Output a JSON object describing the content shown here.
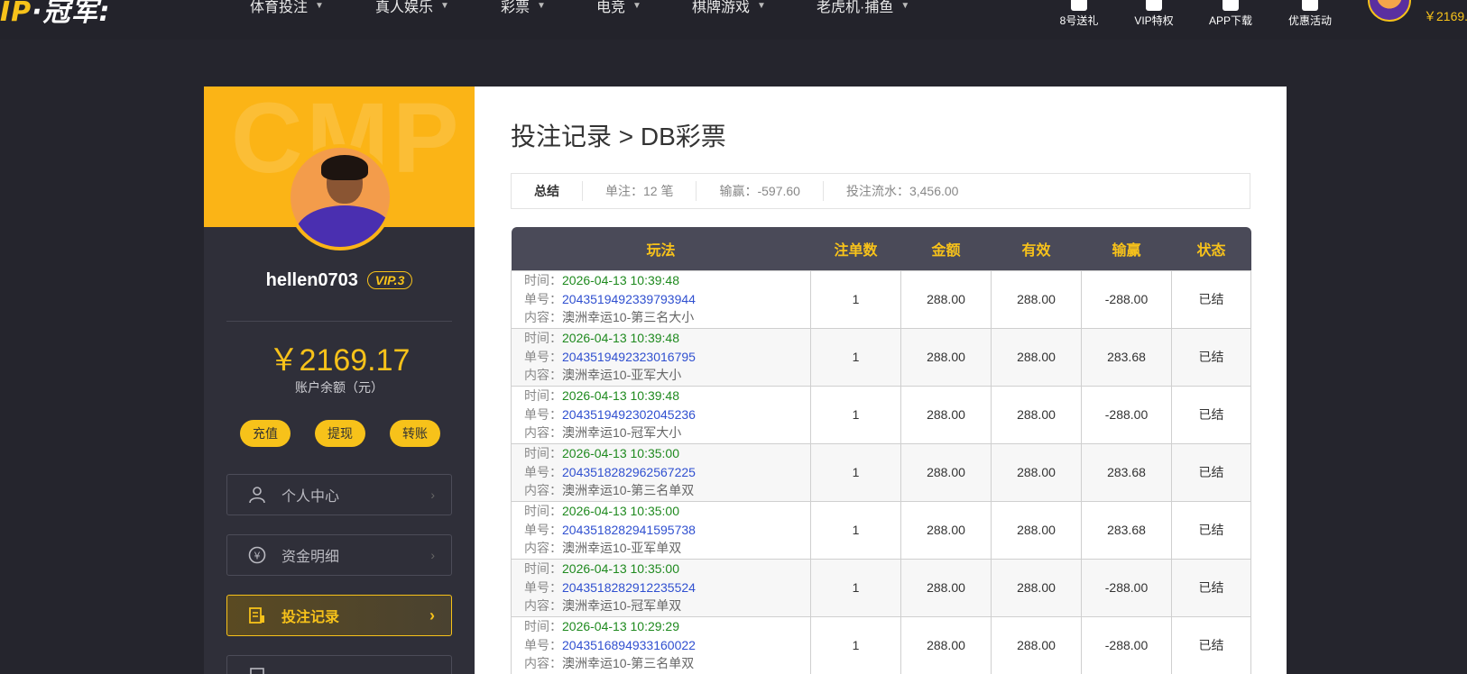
{
  "header": {
    "logo_left": "IP",
    "logo_right": "·冠军:",
    "nav": [
      "体育投注",
      "真人娱乐",
      "彩票",
      "电竞",
      "棋牌游戏",
      "老虎机·捕鱼"
    ],
    "right_links": [
      "8号送礼",
      "VIP特权",
      "APP下载",
      "优惠活动"
    ],
    "balance": "￥2169."
  },
  "sidebar": {
    "watermark": "CMP",
    "username": "hellen0703",
    "vip": "VIP.3",
    "balance": "￥2169.17",
    "balance_label": "账户余额（元）",
    "actions": [
      "充值",
      "提现",
      "转账"
    ],
    "menu": [
      {
        "label": "个人中心",
        "icon": "user-icon"
      },
      {
        "label": "资金明细",
        "icon": "yen-cycle-icon"
      },
      {
        "label": "投注记录",
        "icon": "bet-record-icon",
        "active": true
      }
    ]
  },
  "main": {
    "title": "投注记录 > DB彩票",
    "summary": {
      "head": "总结",
      "orders": "单注：12 笔",
      "win_loss": "输赢：-597.60",
      "turnover": "投注流水：3,456.00"
    },
    "table": {
      "columns": [
        "玩法",
        "注单数",
        "金额",
        "有效",
        "输赢",
        "状态"
      ],
      "labels": {
        "time": "时间：",
        "order": "单号：",
        "content": "内容："
      },
      "rows": [
        {
          "time": "2026-04-13 10:39:48",
          "order": "2043519492339793944",
          "content": "澳洲幸运10-第三名大小",
          "count": "1",
          "amount": "288.00",
          "valid": "288.00",
          "win": "-288.00",
          "status": "已结"
        },
        {
          "time": "2026-04-13 10:39:48",
          "order": "2043519492323016795",
          "content": "澳洲幸运10-亚军大小",
          "count": "1",
          "amount": "288.00",
          "valid": "288.00",
          "win": "283.68",
          "status": "已结"
        },
        {
          "time": "2026-04-13 10:39:48",
          "order": "2043519492302045236",
          "content": "澳洲幸运10-冠军大小",
          "count": "1",
          "amount": "288.00",
          "valid": "288.00",
          "win": "-288.00",
          "status": "已结"
        },
        {
          "time": "2026-04-13 10:35:00",
          "order": "2043518282962567225",
          "content": "澳洲幸运10-第三名单双",
          "count": "1",
          "amount": "288.00",
          "valid": "288.00",
          "win": "283.68",
          "status": "已结"
        },
        {
          "time": "2026-04-13 10:35:00",
          "order": "2043518282941595738",
          "content": "澳洲幸运10-亚军单双",
          "count": "1",
          "amount": "288.00",
          "valid": "288.00",
          "win": "283.68",
          "status": "已结"
        },
        {
          "time": "2026-04-13 10:35:00",
          "order": "2043518282912235524",
          "content": "澳洲幸运10-冠军单双",
          "count": "1",
          "amount": "288.00",
          "valid": "288.00",
          "win": "-288.00",
          "status": "已结"
        },
        {
          "time": "2026-04-13 10:29:29",
          "order": "2043516894933160022",
          "content": "澳洲幸运10-第三名单双",
          "count": "1",
          "amount": "288.00",
          "valid": "288.00",
          "win": "-288.00",
          "status": "已结"
        }
      ]
    }
  },
  "colors": {
    "accent": "#f7c21a",
    "win_negative": "#e01010",
    "win_positive": "#1f8a1f",
    "order_link": "#3050d0"
  }
}
